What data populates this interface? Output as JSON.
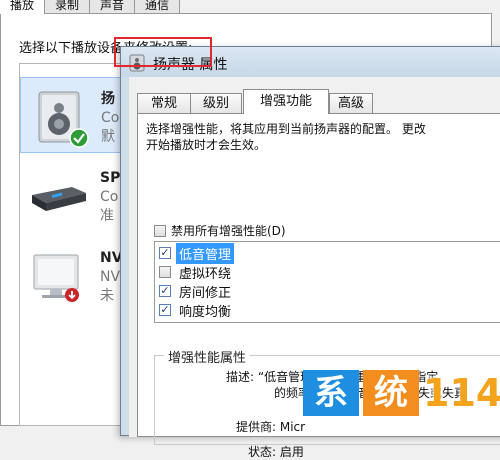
{
  "background_window": {
    "tabs": [
      "播放",
      "录制",
      "声音",
      "通信"
    ],
    "instruction": "选择以下播放设备来修改设置:",
    "devices": [
      {
        "icon": "speaker-icon",
        "name": "扬",
        "sub1": "Co",
        "sub2": "默",
        "selected": true,
        "status": "default-check-icon"
      },
      {
        "icon": "spdif-device-icon",
        "name": "SP",
        "sub1": "Co",
        "sub2": "准",
        "selected": false
      },
      {
        "icon": "nvidia-monitor-icon",
        "name": "NV",
        "sub1": "NV",
        "sub2": "未",
        "selected": false,
        "status": "disconnected-arrow-icon"
      }
    ]
  },
  "dialog": {
    "title": "扬声器 属性",
    "tabs": [
      "常规",
      "级别",
      "增强功能",
      "高级"
    ],
    "active_tab": "增强功能",
    "description_line1": "选择增强性能，将其应用到当前扬声器的配置。  更改",
    "description_line2": "开始播放时才会生效。",
    "disable_all_label": "禁用所有增强性能(D)",
    "disable_all_checked": false,
    "enhancements": [
      {
        "label": "低音管理",
        "checked": true,
        "selected": true
      },
      {
        "label": "虚拟环绕",
        "checked": false,
        "selected": false
      },
      {
        "label": "房间修正",
        "checked": true,
        "selected": false
      },
      {
        "label": "响度均衡",
        "checked": true,
        "selected": false
      }
    ],
    "properties": {
      "group_title": "增强性能属性",
      "desc_line1": "描述: “低音管理”增强或重定向低于指定",
      "desc_line2": "的频率以减少低音信号的丢失或失真",
      "provider": "提供商: Micr",
      "status": "状态: 启用"
    }
  },
  "watermark": {
    "char1": "系",
    "char2": "统",
    "number": "114",
    "colors": {
      "blue": "#1e8fe0",
      "orange": "#f28d1e",
      "number": "#f4a41c"
    }
  },
  "colors": {
    "highlight_box": "#e0282e",
    "selection": "#3399ff"
  }
}
